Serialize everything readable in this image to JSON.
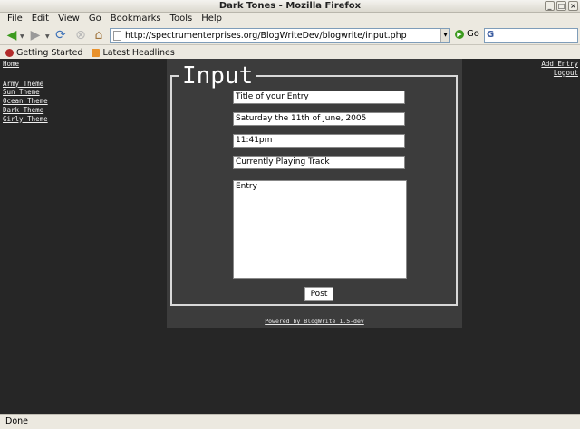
{
  "window": {
    "title": "Dark Tones - Mozilla Firefox"
  },
  "menu": [
    "File",
    "Edit",
    "View",
    "Go",
    "Bookmarks",
    "Tools",
    "Help"
  ],
  "toolbar": {
    "url": "http://spectrumenterprises.org/BlogWriteDev/blogwrite/input.php",
    "go_label": "Go",
    "search_logo": "G"
  },
  "bookmarks": [
    "Getting Started",
    "Latest Headlines"
  ],
  "left_nav": {
    "home": "Home",
    "themes": [
      "Army Theme",
      "Sun Theme",
      "Ocean Theme",
      "Dark Theme",
      "Girly Theme"
    ]
  },
  "right_nav": [
    "Add Entry",
    "Logout"
  ],
  "form": {
    "legend": "Input",
    "title_value": "Title of your Entry",
    "date_value": "Saturday the 11th of June, 2005",
    "time_value": "11:41pm",
    "track_value": "Currently Playing Track",
    "entry_value": "Entry",
    "post_label": "Post"
  },
  "footer": {
    "powered": "Powered by BlogWrite 1.5-dev"
  },
  "status": {
    "text": "Done"
  },
  "colors": {
    "page_bg": "#262626",
    "panel_bg": "#3c3c3c",
    "text": "#ffffff"
  }
}
